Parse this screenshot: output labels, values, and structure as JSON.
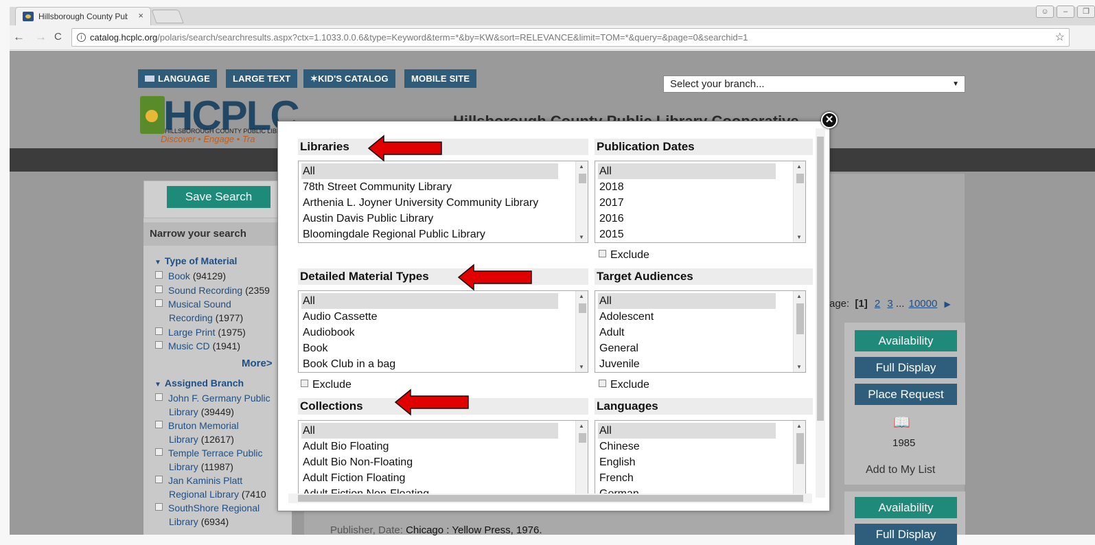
{
  "browser": {
    "tab_title": "Hillsborough County Pub",
    "tab_close": "×",
    "url_host": "catalog.hcplc.org",
    "url_path": "/polaris/search/searchresults.aspx?ctx=1.1033.0.0.6&type=Keyword&term=*&by=KW&sort=RELEVANCE&limit=TOM=*&query=&page=0&searchid=1",
    "back": "←",
    "forward": "→",
    "reload": "C",
    "star": "☆"
  },
  "header": {
    "buttons": [
      "LANGUAGE",
      "LARGE TEXT",
      "KID'S CATALOG",
      "MOBILE SITE"
    ],
    "branch_select": "Select your branch...",
    "logo_text": "HCPLC",
    "logo_sub": "HILLSBOROUGH COUNTY PUBLIC LIBRA",
    "logo_tag": "Discover • Engage • Tra",
    "banner": "Hillsborough County Public Library Cooperative"
  },
  "sidebar": {
    "save_search": "Save Search",
    "narrow_title": "Narrow your search",
    "type_title": "Type of Material",
    "type_items": [
      {
        "label": "Book",
        "count": "(94129)"
      },
      {
        "label": "Sound Recording",
        "count": "(2359"
      },
      {
        "label": "Musical Sound",
        "label2": "Recording",
        "count": "(1977)"
      },
      {
        "label": "Large Print",
        "count": "(1975)"
      },
      {
        "label": "Music CD",
        "count": "(1941)"
      }
    ],
    "more": "More>",
    "branch_title": "Assigned Branch",
    "branch_items": [
      {
        "label": "John F. Germany Public",
        "label2": "Library",
        "count": "(39449)"
      },
      {
        "label": "Bruton Memorial",
        "label2": "Library",
        "count": "(12617)"
      },
      {
        "label": "Temple Terrace Public",
        "label2": "Library",
        "count": "(11987)"
      },
      {
        "label": "Jan Kaminis Platt",
        "label2": "Regional Library",
        "count": "(7410"
      },
      {
        "label": "SouthShore Regional",
        "label2": "Library",
        "count": "(6934)"
      }
    ]
  },
  "results": {
    "pager_label": "age:",
    "pager_current": "[1]",
    "pager_pages": [
      "2",
      "3"
    ],
    "pager_ellipsis": "...",
    "pager_last": "10000",
    "availability": "Availability",
    "full_display": "Full Display",
    "place_request": "Place Request",
    "year": "1985",
    "add_list": "Add to My List",
    "availability2": "Availability",
    "full_display2": "Full Display",
    "publisher_label": "Publisher, Date:",
    "publisher_value": "Chicago : Yellow Press, 1976."
  },
  "modal": {
    "close": "✕",
    "libraries": {
      "title": "Libraries",
      "options": [
        "All",
        "78th Street Community Library",
        "Arthenia L. Joyner University Community Library",
        "Austin Davis Public Library",
        "Bloomingdale Regional Public Library"
      ]
    },
    "publication_dates": {
      "title": "Publication Dates",
      "options": [
        "All",
        "2018",
        "2017",
        "2016",
        "2015"
      ],
      "exclude": "Exclude"
    },
    "material_types": {
      "title": "Detailed Material Types",
      "options": [
        "All",
        "Audio Cassette",
        "Audiobook",
        "Book",
        "Book Club in a bag"
      ],
      "exclude": "Exclude"
    },
    "target_audiences": {
      "title": "Target Audiences",
      "options": [
        "All",
        "Adolescent",
        "Adult",
        "General",
        "Juvenile"
      ],
      "exclude": "Exclude"
    },
    "collections": {
      "title": "Collections",
      "options": [
        "All",
        "Adult Bio Floating",
        "Adult Bio Non-Floating",
        "Adult Fiction Floating",
        "Adult Fiction Non-Floating"
      ]
    },
    "languages": {
      "title": "Languages",
      "options": [
        "All",
        "Chinese",
        "English",
        "French",
        "German"
      ]
    }
  },
  "colors": {
    "annotation_arrow": "#e00000",
    "teal_button": "#1f8a7a",
    "blue_button": "#2e5e7c",
    "header_button": "#2e5c7a"
  }
}
